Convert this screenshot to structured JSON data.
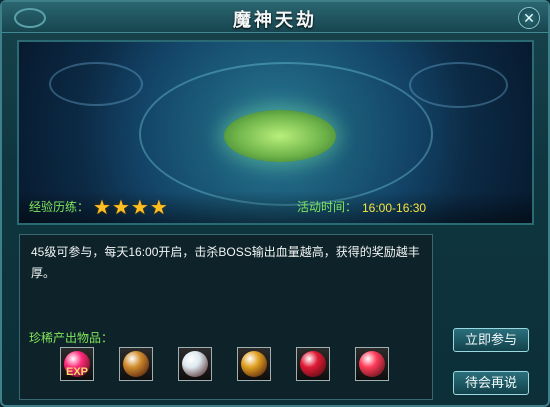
{
  "window": {
    "title": "魔神天劫",
    "close_glyph": "✕"
  },
  "scene": {
    "exp_label": "经验历练：",
    "stars": 4,
    "time_label": "活动时间：",
    "time_value": "16:00-16:30"
  },
  "description": {
    "text": "45级可参与，每天16:00开启，击杀BOSS输出血量越高，获得的奖励越丰厚。"
  },
  "rewards": {
    "label": "珍稀产出物品：",
    "items": [
      {
        "name": "exp-orb",
        "text": "EXP",
        "color": "#ff2a7a"
      },
      {
        "name": "gem-orb",
        "text": "",
        "color": "#d08c2c"
      },
      {
        "name": "helmet",
        "text": "",
        "color": "#dce8ef"
      },
      {
        "name": "ring",
        "text": "",
        "color": "#e0a020"
      },
      {
        "name": "ruby",
        "text": "",
        "color": "#e01a35"
      },
      {
        "name": "red-crystal",
        "text": "",
        "color": "#ff3b59"
      }
    ]
  },
  "actions": {
    "join_label": "立即参与",
    "later_label": "待会再说"
  }
}
